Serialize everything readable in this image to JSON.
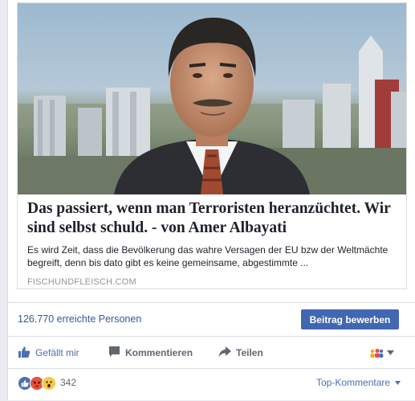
{
  "link_preview": {
    "title": "Das passiert, wenn man Terroristen heranzüchtet. Wir sind selbst schuld. - von Amer Albayati",
    "description": "Es wird Zeit, dass die Bevölkerung das wahre Versagen der EU bzw der Weltmächte begreift, denn bis dato gibt es keine gemeinsame, abgestimmte ...",
    "domain": "FISCHUNDFLEISCH.COM"
  },
  "reach": {
    "text": "126.770 erreichte Personen",
    "boost_label": "Beitrag bewerben"
  },
  "actions": {
    "like_label": "Gefällt mir",
    "comment_label": "Kommentieren",
    "share_label": "Teilen"
  },
  "reactions": {
    "count": "342",
    "top_comments_label": "Top-Kommentare",
    "types": [
      "like",
      "angry",
      "wow"
    ]
  },
  "colors": {
    "link": "#365899",
    "button": "#4267b2",
    "muted": "#90949c",
    "action_gray": "#606770"
  }
}
